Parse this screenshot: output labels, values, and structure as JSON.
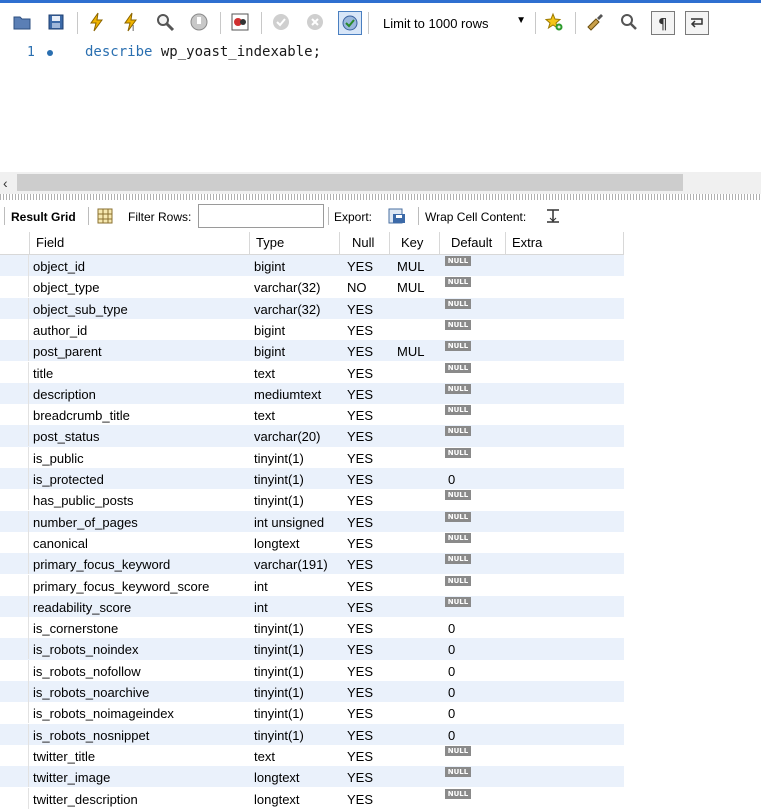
{
  "toolbar": {
    "limit_label": "Limit to 1000 rows",
    "limit_arrow": "▼"
  },
  "editor": {
    "line_number": "1",
    "keyword": "describe",
    "identifier": "wp_yoast_indexable;"
  },
  "scroll": {
    "left_arrow": "‹"
  },
  "results_bar": {
    "result_grid": "Result Grid",
    "filter_rows": "Filter Rows:",
    "export": "Export:",
    "wrap_cell": "Wrap Cell Content:"
  },
  "grid": {
    "columns": [
      "Field",
      "Type",
      "Null",
      "Key",
      "Default",
      "Extra"
    ],
    "null_badge": "NULL",
    "rows": [
      {
        "field": "object_id",
        "type": "bigint",
        "null": "YES",
        "key": "MUL",
        "default": "NULL"
      },
      {
        "field": "object_type",
        "type": "varchar(32)",
        "null": "NO",
        "key": "MUL",
        "default": "NULL"
      },
      {
        "field": "object_sub_type",
        "type": "varchar(32)",
        "null": "YES",
        "key": "",
        "default": "NULL"
      },
      {
        "field": "author_id",
        "type": "bigint",
        "null": "YES",
        "key": "",
        "default": "NULL"
      },
      {
        "field": "post_parent",
        "type": "bigint",
        "null": "YES",
        "key": "MUL",
        "default": "NULL"
      },
      {
        "field": "title",
        "type": "text",
        "null": "YES",
        "key": "",
        "default": "NULL"
      },
      {
        "field": "description",
        "type": "mediumtext",
        "null": "YES",
        "key": "",
        "default": "NULL"
      },
      {
        "field": "breadcrumb_title",
        "type": "text",
        "null": "YES",
        "key": "",
        "default": "NULL"
      },
      {
        "field": "post_status",
        "type": "varchar(20)",
        "null": "YES",
        "key": "",
        "default": "NULL"
      },
      {
        "field": "is_public",
        "type": "tinyint(1)",
        "null": "YES",
        "key": "",
        "default": "NULL"
      },
      {
        "field": "is_protected",
        "type": "tinyint(1)",
        "null": "YES",
        "key": "",
        "default": "0"
      },
      {
        "field": "has_public_posts",
        "type": "tinyint(1)",
        "null": "YES",
        "key": "",
        "default": "NULL"
      },
      {
        "field": "number_of_pages",
        "type": "int unsigned",
        "null": "YES",
        "key": "",
        "default": "NULL"
      },
      {
        "field": "canonical",
        "type": "longtext",
        "null": "YES",
        "key": "",
        "default": "NULL"
      },
      {
        "field": "primary_focus_keyword",
        "type": "varchar(191)",
        "null": "YES",
        "key": "",
        "default": "NULL"
      },
      {
        "field": "primary_focus_keyword_score",
        "type": "int",
        "null": "YES",
        "key": "",
        "default": "NULL"
      },
      {
        "field": "readability_score",
        "type": "int",
        "null": "YES",
        "key": "",
        "default": "NULL"
      },
      {
        "field": "is_cornerstone",
        "type": "tinyint(1)",
        "null": "YES",
        "key": "",
        "default": "0"
      },
      {
        "field": "is_robots_noindex",
        "type": "tinyint(1)",
        "null": "YES",
        "key": "",
        "default": "0"
      },
      {
        "field": "is_robots_nofollow",
        "type": "tinyint(1)",
        "null": "YES",
        "key": "",
        "default": "0"
      },
      {
        "field": "is_robots_noarchive",
        "type": "tinyint(1)",
        "null": "YES",
        "key": "",
        "default": "0"
      },
      {
        "field": "is_robots_noimageindex",
        "type": "tinyint(1)",
        "null": "YES",
        "key": "",
        "default": "0"
      },
      {
        "field": "is_robots_nosnippet",
        "type": "tinyint(1)",
        "null": "YES",
        "key": "",
        "default": "0"
      },
      {
        "field": "twitter_title",
        "type": "text",
        "null": "YES",
        "key": "",
        "default": "NULL"
      },
      {
        "field": "twitter_image",
        "type": "longtext",
        "null": "YES",
        "key": "",
        "default": "NULL"
      },
      {
        "field": "twitter_description",
        "type": "longtext",
        "null": "YES",
        "key": "",
        "default": "NULL"
      }
    ]
  }
}
